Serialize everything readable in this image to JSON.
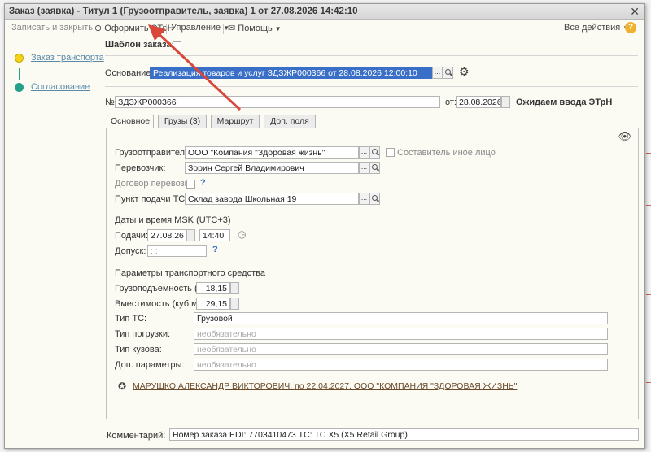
{
  "window": {
    "title": "Заказ (заявка) - Титул 1 (Грузоотправитель, заявка) 1 от 27.08.2026 14:42:10"
  },
  "toolbar": {
    "save_close": "Записать и закрыть",
    "etrn": "Оформить ЭТрН",
    "management": "Управление",
    "help": "Помощь",
    "all_actions": "Все действия",
    "help_q": "?"
  },
  "steps": [
    {
      "label": "Заказ транспорта",
      "color": "#f2d21a"
    },
    {
      "label": "Согласование",
      "color": "#25a088"
    }
  ],
  "header": {
    "template_label": "Шаблон заказа:",
    "basis_label": "Основание:",
    "basis_value": "Реализация товаров и услуг ЗДЗЖР000366 от 28.08.2026 12:00:10",
    "number_label": "№:",
    "number_value": "ЗДЗЖР000366",
    "date_label": "от:",
    "date_value": "28.08.2026",
    "status": "Ожидаем ввода ЭТрН"
  },
  "tabs": [
    "Основное",
    "Грузы (3)",
    "Маршрут",
    "Доп. поля"
  ],
  "main": {
    "shipper_label": "Грузоотправитель:",
    "shipper_value": "ООО \"Компания \"Здоровая жизнь\"",
    "other_face_label": "Составитель иное лицо",
    "carrier_label": "Перевозчик:",
    "carrier_value": "Зорин Сергей Владимирович",
    "contract_label": "Договор перевозки:",
    "q": "?",
    "pickup_label": "Пункт подачи ТС:",
    "pickup_value": "Склад завода Школьная 19",
    "dates_header": "Даты и время MSK (UTC+3)",
    "supply_label": "Подачи:",
    "supply_date": "27.08.26",
    "supply_time": "14:40",
    "admit_label": "Допуск:",
    "admit_value": " : :",
    "vehicle_header": "Параметры транспортного средства",
    "capacity_label": "Грузоподъемность (т):",
    "capacity_value": "18,15",
    "volume_label": "Вместимость (куб.м.):",
    "volume_value": "29,15",
    "vtype_label": "Тип ТС:",
    "vtype_value": "Грузовой",
    "load_label": "Тип погрузки:",
    "load_placeholder": "необязательно",
    "body_label": "Тип кузова:",
    "body_placeholder": "необязательно",
    "extra_label": "Доп. параметры:",
    "extra_placeholder": "необязательно",
    "signature": "МАРУШКО АЛЕКСАНДР ВИКТОРОВИЧ, по 22.04.2027, ООО \"КОМПАНИЯ \"ЗДОРОВАЯ ЖИЗНЬ\""
  },
  "footer": {
    "comment_label": "Комментарий:",
    "comment_value": "Номер заказа EDI: 7703410473 ТС: ТС X5 (X5 Retail Group)"
  },
  "colors": {
    "arrow": "#d9473a",
    "selection": "#3a6fc8"
  }
}
